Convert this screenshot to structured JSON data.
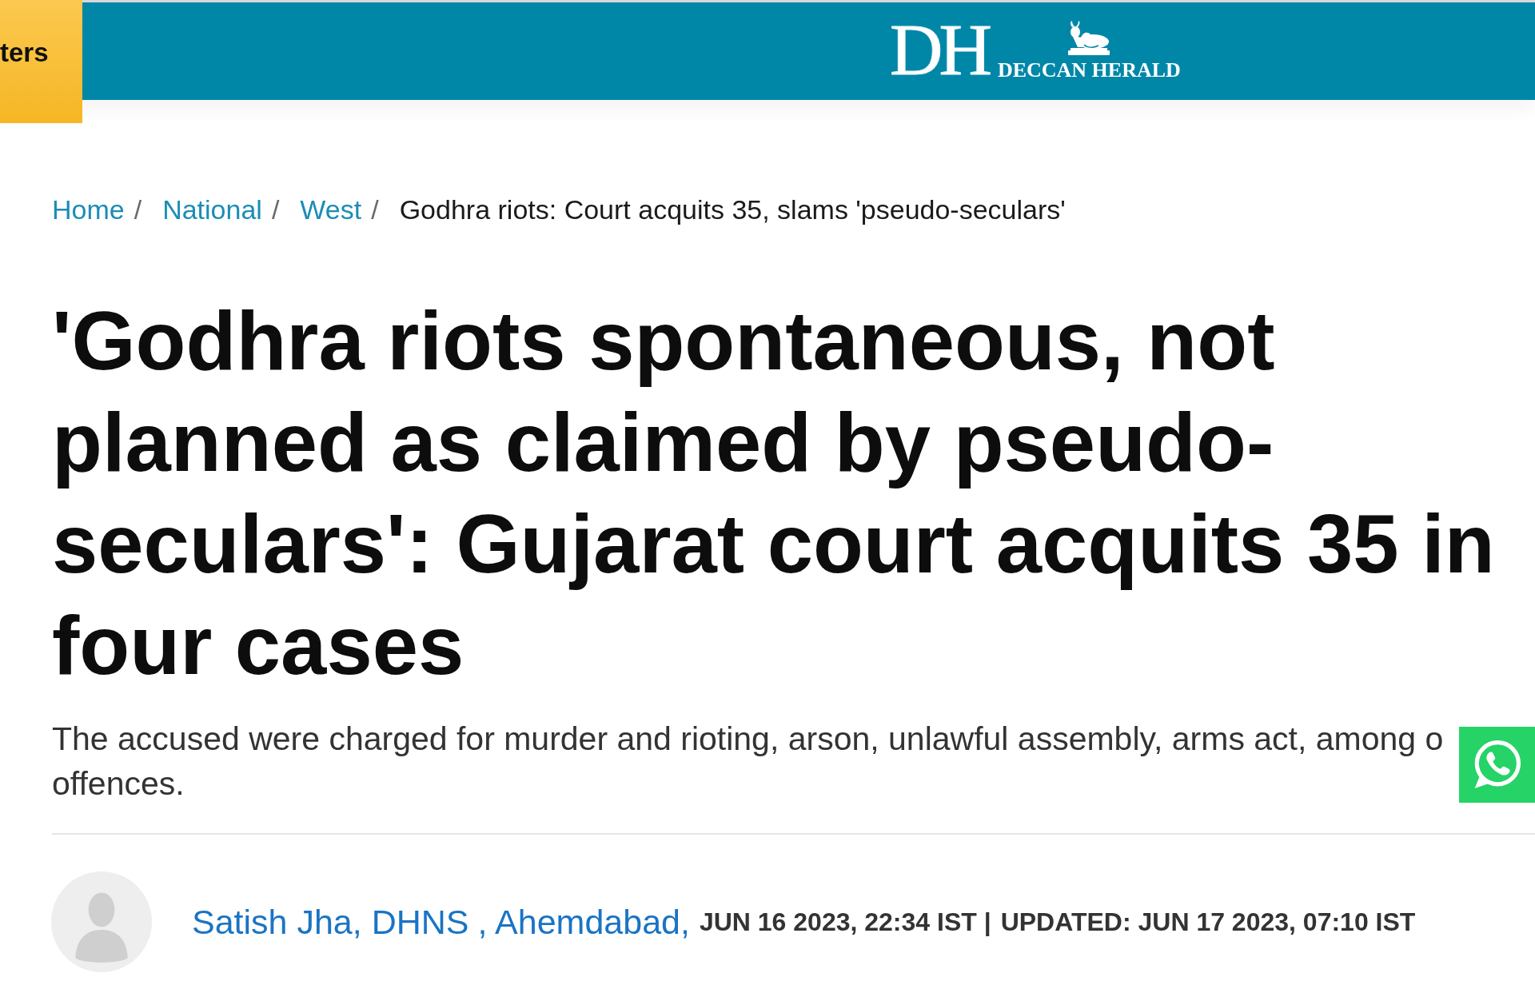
{
  "header": {
    "tab": {
      "label": "ters"
    },
    "logo": {
      "monogram": "DH",
      "wordmark": "DECCAN HERALD"
    }
  },
  "breadcrumb": [
    {
      "label": "Home",
      "kind": "link",
      "separator": "/"
    },
    {
      "label": "National",
      "kind": "link",
      "separator": "/"
    },
    {
      "label": "West",
      "kind": "link",
      "separator": "/"
    },
    {
      "label": "Godhra riots: Court acquits 35, slams 'pseudo-seculars'",
      "kind": "current"
    }
  ],
  "article": {
    "headline": "'Godhra riots spontaneous, not planned as claimed by pseudo-seculars': Gujarat court acquits 35 in four cases",
    "summary_lines": [
      "The accused were charged for murder and rioting, arson, unlawful assembly, arms act, among o",
      "offences."
    ]
  },
  "byline": {
    "author": "Satish Jha, DHNS",
    "location": ", Ahemdabad,",
    "published": "JUN 16 2023, 22:34 IST |",
    "updated": "UPDATED: JUN 17 2023, 07:10 IST"
  }
}
